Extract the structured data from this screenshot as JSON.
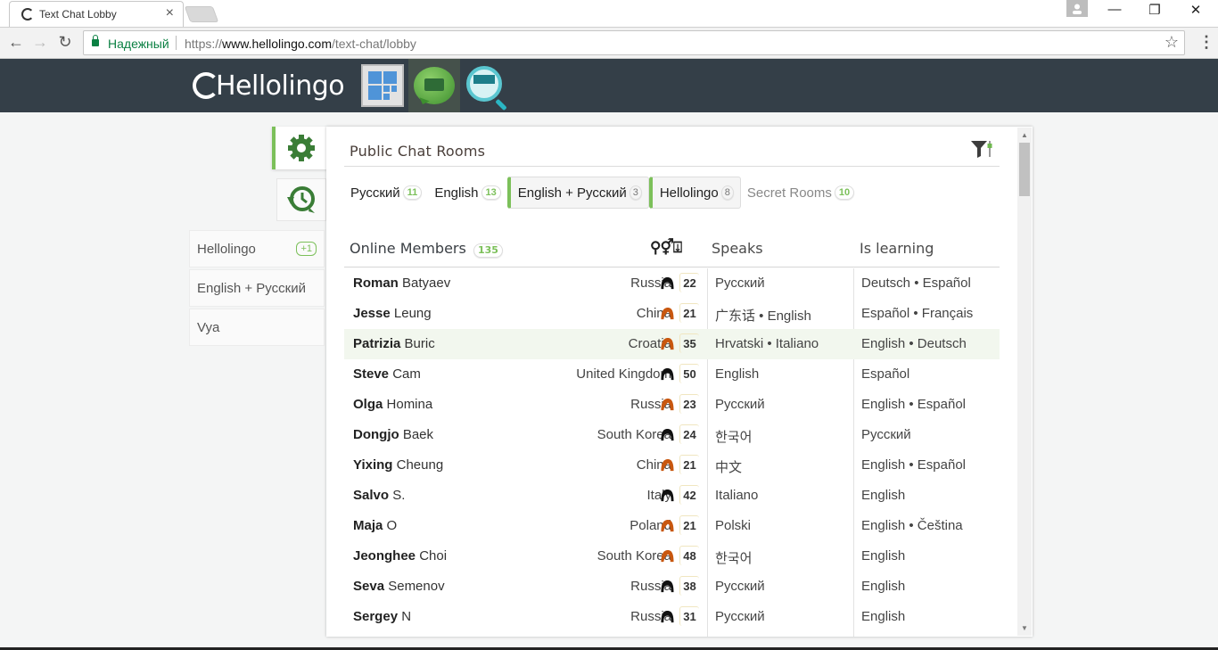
{
  "browser": {
    "tab_title": "Text Chat Lobby",
    "secure_label": "Надежный",
    "url_scheme": "https://",
    "url_host": "www.hellolingo.com",
    "url_path": "/text-chat/lobby"
  },
  "site": {
    "logo_text": "Hellolingo",
    "nav": [
      {
        "name": "dashboard-icon"
      },
      {
        "name": "text-chat-icon",
        "active": true
      },
      {
        "name": "find-partner-icon"
      }
    ]
  },
  "sidebar": {
    "items": [
      {
        "label": "Hellolingo",
        "badge": "+1"
      },
      {
        "label": "English + Русский",
        "badge": ""
      },
      {
        "label": "Vya",
        "badge": ""
      }
    ]
  },
  "rooms": {
    "title": "Public Chat Rooms",
    "list": [
      {
        "label": "Русский",
        "count": "11",
        "open": false
      },
      {
        "label": "English",
        "count": "13",
        "open": false
      },
      {
        "label": "English + Русский",
        "count": "3",
        "open": true
      },
      {
        "label": "Hellolingo",
        "count": "8",
        "open": true
      },
      {
        "label": "Secret Rooms",
        "count": "10",
        "open": false
      }
    ]
  },
  "members": {
    "title": "Online Members",
    "count": "135",
    "sort_icons": "location-gender-age",
    "col_speaks": "Speaks",
    "col_learning": "Is learning",
    "rows": [
      {
        "first": "Roman",
        "last": "Batyaev",
        "country": "Russia",
        "gender": "male",
        "age": "22",
        "speaks": "Русский",
        "learning": "Deutsch • Español"
      },
      {
        "first": "Jesse",
        "last": "Leung",
        "country": "China",
        "gender": "female",
        "age": "21",
        "speaks": "广东话 • English",
        "learning": "Español • Français"
      },
      {
        "first": "Patrizia",
        "last": "Buric",
        "country": "Croatia",
        "gender": "female",
        "age": "35",
        "speaks": "Hrvatski • Italiano",
        "learning": "English • Deutsch",
        "highlight": true
      },
      {
        "first": "Steve",
        "last": "Cam",
        "country": "United Kingdom",
        "gender": "male",
        "age": "50",
        "speaks": "English",
        "learning": "Español"
      },
      {
        "first": "Olga",
        "last": "Homina",
        "country": "Russia",
        "gender": "female",
        "age": "23",
        "speaks": "Русский",
        "learning": "English • Español"
      },
      {
        "first": "Dongjo",
        "last": "Baek",
        "country": "South Korea",
        "gender": "male",
        "age": "24",
        "speaks": "한국어",
        "learning": "Русский"
      },
      {
        "first": "Yixing",
        "last": "Cheung",
        "country": "China",
        "gender": "female",
        "age": "21",
        "speaks": "中文",
        "learning": "English • Español"
      },
      {
        "first": "Salvo",
        "last": "S.",
        "country": "Italy",
        "gender": "male",
        "age": "42",
        "speaks": "Italiano",
        "learning": "English"
      },
      {
        "first": "Maja",
        "last": "O",
        "country": "Poland",
        "gender": "female",
        "age": "21",
        "speaks": "Polski",
        "learning": "English • Čeština"
      },
      {
        "first": "Jeonghee",
        "last": "Choi",
        "country": "South Korea",
        "gender": "female",
        "age": "48",
        "speaks": "한국어",
        "learning": "English"
      },
      {
        "first": "Seva",
        "last": "Semenov",
        "country": "Russia",
        "gender": "male",
        "age": "38",
        "speaks": "Русский",
        "learning": "English"
      },
      {
        "first": "Sergey",
        "last": "N",
        "country": "Russia",
        "gender": "male",
        "age": "31",
        "speaks": "Русский",
        "learning": "English"
      }
    ]
  },
  "colors": {
    "accent_green": "#7cc05a",
    "header_bg": "#343f48",
    "female_hair": "#c8570f",
    "male_hair": "#111111",
    "highlight_row": "#f2f7ee"
  }
}
